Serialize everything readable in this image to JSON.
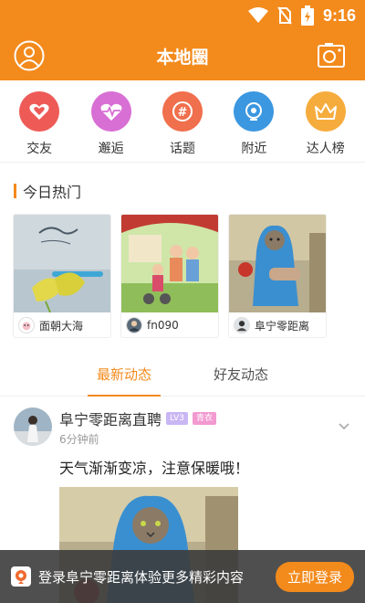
{
  "status_bar": {
    "time": "9:16"
  },
  "header": {
    "title": "本地圈"
  },
  "shortcuts": [
    {
      "label": "交友",
      "icon": "heart-icon",
      "color": "#ee5b57"
    },
    {
      "label": "邂逅",
      "icon": "heartbeat-icon",
      "color": "#d86fd4"
    },
    {
      "label": "话题",
      "icon": "hashtag-icon",
      "color": "#f06f4c"
    },
    {
      "label": "附近",
      "icon": "location-icon",
      "color": "#3b97e0"
    },
    {
      "label": "达人榜",
      "icon": "crown-icon",
      "color": "#f6ac3c"
    }
  ],
  "hot_section": {
    "title": "今日热门",
    "cards": [
      {
        "user": "面朝大海"
      },
      {
        "user": "fn090"
      },
      {
        "user": "阜宁零距离"
      }
    ]
  },
  "feed_tabs": [
    {
      "label": "最新动态",
      "active": true
    },
    {
      "label": "好友动态",
      "active": false
    }
  ],
  "post": {
    "name": "阜宁零距离直聘",
    "level": "LV3",
    "tag": "青衣",
    "time": "6分钟前",
    "text": "天气渐渐变凉，注意保暖哦！"
  },
  "login_bar": {
    "message": "登录阜宁零距离体验更多精彩内容",
    "button": "立即登录"
  },
  "colors": {
    "accent": "#f38a1c"
  }
}
